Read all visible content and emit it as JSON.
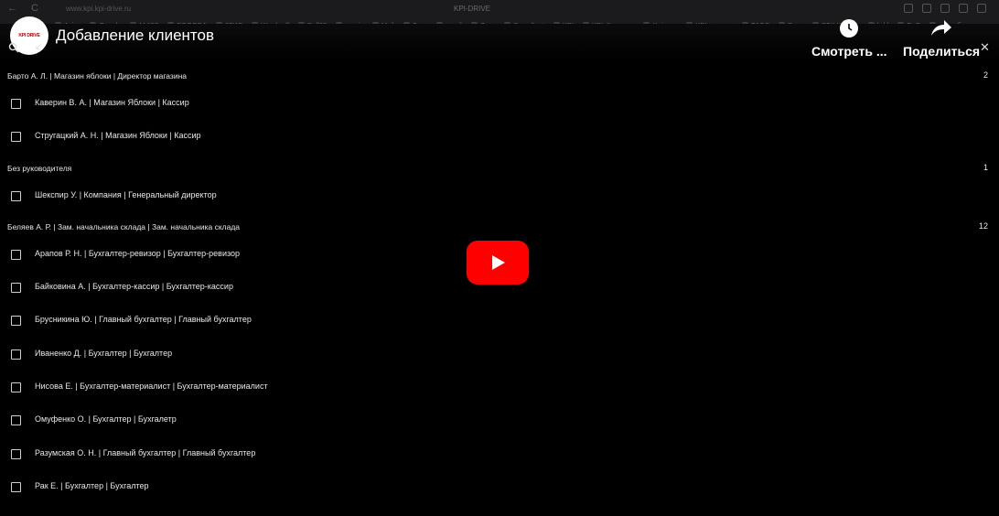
{
  "browser": {
    "back": "←",
    "reload": "C",
    "url": "www.kpi.kpi-drive.ru",
    "tab_title": "KPI-DRIVE",
    "bookmarks": [
      "Aviso",
      "Google",
      "M 150",
      "POGODA",
      "2ГИС",
      "Word-pdf",
      "Roll20",
      "music",
      "Mail",
      "Диск",
      "gmail",
      "Диск",
      "Speedtest",
      "KPI",
      "KPI. Клиенты",
      "Kpi-now",
      "KPI - новые",
      "ТАСС",
      "Рнес",
      "РБК Крипто",
      "hdd",
      "DnD",
      "автообн"
    ]
  },
  "youtube": {
    "channel_logo_text": "KPI DRIVE",
    "video_title": "Добавление клиентов",
    "watch_later_label": "Смотреть ...",
    "share_label": "Поделиться",
    "close_symbol": "✕",
    "loader_symbol": "↙"
  },
  "groups": [
    {
      "name": "Барто А. Л. | Магазин яблоки | Директор магазина",
      "count": "2",
      "items": [
        "Каверин В. А. | Магазин Яблоки | Кассир",
        "Стругацкий А. Н. | Магазин Яблоки | Кассир"
      ]
    },
    {
      "name": "Без руководителя",
      "count": "1",
      "items": [
        "Шекспир У. | Компания | Генеральный директор"
      ]
    },
    {
      "name": "Беляев А. Р. | Зам. начальника склада | Зам. начальника склада",
      "count": "12",
      "items": [
        "Арапов Р. Н. | Бухгалтер-ревизор | Бухгалтер-ревизор",
        "Байковина А. | Бухгалтер-кассир | Бухгалтер-кассир",
        "Брусникина Ю. | Главный бухгалтер | Главный бухгалтер",
        "Иваненко Д. | Бухгалтер | Бухгалтер",
        "Нисова Е. | Бухгалтер-материалист | Бухгалтер-материалист",
        "Омуфенко О. | Бухгалтер | Бухгалетр",
        "Разумская О. Н. | Главный бухгалтер | Главный бухгалтер",
        "Рак Е. | Бухгалтер | Бухгалтер"
      ]
    }
  ],
  "colors": {
    "play_button": "#ff0000",
    "background": "#000000"
  }
}
